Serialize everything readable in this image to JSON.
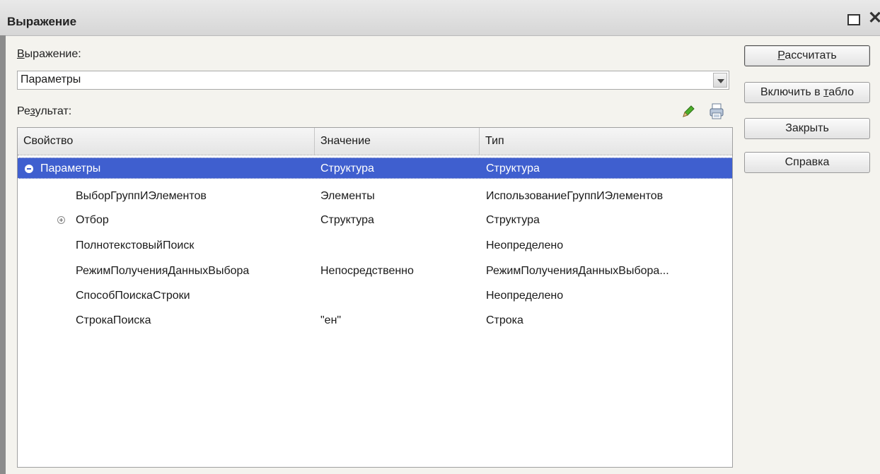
{
  "window": {
    "title": "Выражение"
  },
  "expression": {
    "label_prefix": "",
    "label_accel": "В",
    "label_rest": "ыражение:",
    "value": "Параметры"
  },
  "result": {
    "label_prefix": "Ре",
    "label_accel": "з",
    "label_rest": "ультат:",
    "icons": [
      "pencil-icon",
      "print-icon"
    ]
  },
  "table": {
    "columns": [
      "Свойство",
      "Значение",
      "Тип"
    ],
    "rows": [
      {
        "property": "Параметры",
        "value": "Структура",
        "type": "Структура",
        "selected": true,
        "toggle": "collapse"
      },
      {
        "property": "ВыборГруппИЭлементов",
        "value": "Элементы",
        "type": "ИспользованиеГруппИЭлементов"
      },
      {
        "property": "Отбор",
        "value": "Структура",
        "type": "Структура",
        "toggle": "expand"
      },
      {
        "property": "ПолнотекстовыйПоиск",
        "value": "",
        "type": "Неопределено"
      },
      {
        "property": "РежимПолученияДанныхВыбора",
        "value": "Непосредственно",
        "type": "РежимПолученияДанныхВыбора..."
      },
      {
        "property": "СпособПоискаСтроки",
        "value": "",
        "type": "Неопределено"
      },
      {
        "property": "СтрокаПоиска",
        "value": "\"ен\"",
        "type": "Строка"
      }
    ]
  },
  "buttons": {
    "calculate": {
      "accel": "Р",
      "rest": "ассчитать"
    },
    "include": {
      "prefix": "Включить в ",
      "accel": "т",
      "rest": "абло"
    },
    "close": "Закрыть",
    "help": "Справка"
  },
  "colors": {
    "selection": "#3f5fcf",
    "title_bar": "#dcdcdc",
    "background": "#f4f3ee"
  }
}
